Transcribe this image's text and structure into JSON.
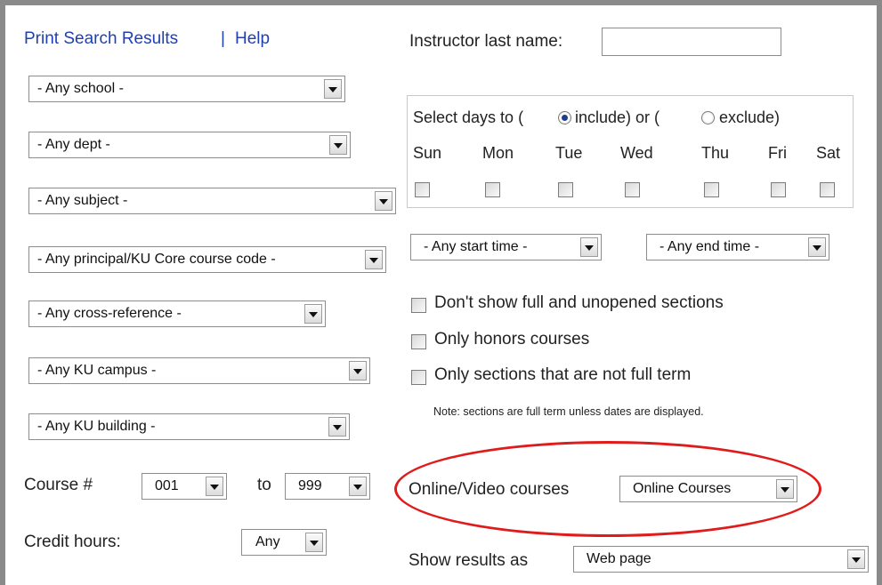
{
  "links": {
    "print_results": "Print Search Results",
    "separator": "|",
    "help": "Help"
  },
  "instructor": {
    "label": "Instructor last name:",
    "value": ""
  },
  "dropdowns": {
    "school": "- Any school -",
    "dept": "- Any dept -",
    "subject": "- Any subject -",
    "core_code": "- Any principal/KU Core course code -",
    "cross_reference": "- Any cross-reference -",
    "campus": "- Any KU campus -",
    "building": "- Any KU building -"
  },
  "course_number": {
    "label": "Course #",
    "from": "001",
    "to_label": "to",
    "to": "999"
  },
  "credit_hours": {
    "label": "Credit hours:",
    "value": "Any"
  },
  "days": {
    "text_before": "Select days to (",
    "include_label": "include) or (",
    "exclude_label": "exclude)",
    "selected_mode": "include",
    "items": [
      {
        "label": "Sun",
        "checked": false
      },
      {
        "label": "Mon",
        "checked": false
      },
      {
        "label": "Tue",
        "checked": false
      },
      {
        "label": "Wed",
        "checked": false
      },
      {
        "label": "Thu",
        "checked": false
      },
      {
        "label": "Fri",
        "checked": false
      },
      {
        "label": "Sat",
        "checked": false
      }
    ]
  },
  "time": {
    "start": "- Any start time -",
    "end": "- Any end time -"
  },
  "options": {
    "full_unopened": "Don't show full and unopened sections",
    "honors": "Only honors courses",
    "not_full_term": "Only sections that are not full term",
    "note": "Note: sections are full term unless dates are displayed."
  },
  "online": {
    "label": "Online/Video courses",
    "value": "Online Courses"
  },
  "results": {
    "label": "Show results as",
    "value": "Web page"
  },
  "colors": {
    "link": "#1f3fb3",
    "highlight_ellipse": "#e01b1b",
    "frame": "#8a8a8a"
  }
}
